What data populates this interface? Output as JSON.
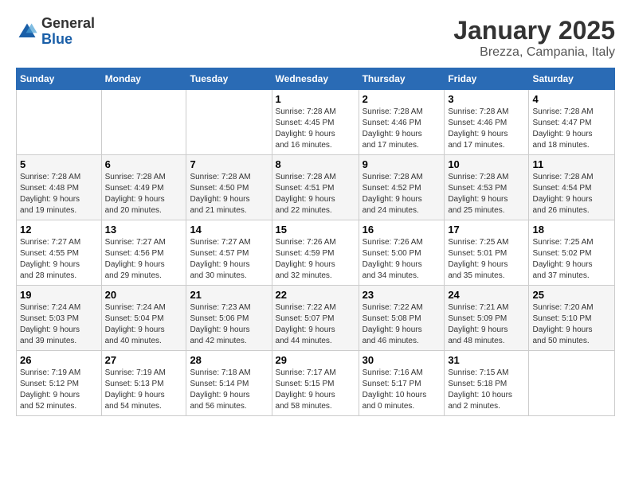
{
  "logo": {
    "general": "General",
    "blue": "Blue"
  },
  "header": {
    "month": "January 2025",
    "location": "Brezza, Campania, Italy"
  },
  "days_of_week": [
    "Sunday",
    "Monday",
    "Tuesday",
    "Wednesday",
    "Thursday",
    "Friday",
    "Saturday"
  ],
  "weeks": [
    [
      {
        "day": "",
        "info": ""
      },
      {
        "day": "",
        "info": ""
      },
      {
        "day": "",
        "info": ""
      },
      {
        "day": "1",
        "info": "Sunrise: 7:28 AM\nSunset: 4:45 PM\nDaylight: 9 hours\nand 16 minutes."
      },
      {
        "day": "2",
        "info": "Sunrise: 7:28 AM\nSunset: 4:46 PM\nDaylight: 9 hours\nand 17 minutes."
      },
      {
        "day": "3",
        "info": "Sunrise: 7:28 AM\nSunset: 4:46 PM\nDaylight: 9 hours\nand 17 minutes."
      },
      {
        "day": "4",
        "info": "Sunrise: 7:28 AM\nSunset: 4:47 PM\nDaylight: 9 hours\nand 18 minutes."
      }
    ],
    [
      {
        "day": "5",
        "info": "Sunrise: 7:28 AM\nSunset: 4:48 PM\nDaylight: 9 hours\nand 19 minutes."
      },
      {
        "day": "6",
        "info": "Sunrise: 7:28 AM\nSunset: 4:49 PM\nDaylight: 9 hours\nand 20 minutes."
      },
      {
        "day": "7",
        "info": "Sunrise: 7:28 AM\nSunset: 4:50 PM\nDaylight: 9 hours\nand 21 minutes."
      },
      {
        "day": "8",
        "info": "Sunrise: 7:28 AM\nSunset: 4:51 PM\nDaylight: 9 hours\nand 22 minutes."
      },
      {
        "day": "9",
        "info": "Sunrise: 7:28 AM\nSunset: 4:52 PM\nDaylight: 9 hours\nand 24 minutes."
      },
      {
        "day": "10",
        "info": "Sunrise: 7:28 AM\nSunset: 4:53 PM\nDaylight: 9 hours\nand 25 minutes."
      },
      {
        "day": "11",
        "info": "Sunrise: 7:28 AM\nSunset: 4:54 PM\nDaylight: 9 hours\nand 26 minutes."
      }
    ],
    [
      {
        "day": "12",
        "info": "Sunrise: 7:27 AM\nSunset: 4:55 PM\nDaylight: 9 hours\nand 28 minutes."
      },
      {
        "day": "13",
        "info": "Sunrise: 7:27 AM\nSunset: 4:56 PM\nDaylight: 9 hours\nand 29 minutes."
      },
      {
        "day": "14",
        "info": "Sunrise: 7:27 AM\nSunset: 4:57 PM\nDaylight: 9 hours\nand 30 minutes."
      },
      {
        "day": "15",
        "info": "Sunrise: 7:26 AM\nSunset: 4:59 PM\nDaylight: 9 hours\nand 32 minutes."
      },
      {
        "day": "16",
        "info": "Sunrise: 7:26 AM\nSunset: 5:00 PM\nDaylight: 9 hours\nand 34 minutes."
      },
      {
        "day": "17",
        "info": "Sunrise: 7:25 AM\nSunset: 5:01 PM\nDaylight: 9 hours\nand 35 minutes."
      },
      {
        "day": "18",
        "info": "Sunrise: 7:25 AM\nSunset: 5:02 PM\nDaylight: 9 hours\nand 37 minutes."
      }
    ],
    [
      {
        "day": "19",
        "info": "Sunrise: 7:24 AM\nSunset: 5:03 PM\nDaylight: 9 hours\nand 39 minutes."
      },
      {
        "day": "20",
        "info": "Sunrise: 7:24 AM\nSunset: 5:04 PM\nDaylight: 9 hours\nand 40 minutes."
      },
      {
        "day": "21",
        "info": "Sunrise: 7:23 AM\nSunset: 5:06 PM\nDaylight: 9 hours\nand 42 minutes."
      },
      {
        "day": "22",
        "info": "Sunrise: 7:22 AM\nSunset: 5:07 PM\nDaylight: 9 hours\nand 44 minutes."
      },
      {
        "day": "23",
        "info": "Sunrise: 7:22 AM\nSunset: 5:08 PM\nDaylight: 9 hours\nand 46 minutes."
      },
      {
        "day": "24",
        "info": "Sunrise: 7:21 AM\nSunset: 5:09 PM\nDaylight: 9 hours\nand 48 minutes."
      },
      {
        "day": "25",
        "info": "Sunrise: 7:20 AM\nSunset: 5:10 PM\nDaylight: 9 hours\nand 50 minutes."
      }
    ],
    [
      {
        "day": "26",
        "info": "Sunrise: 7:19 AM\nSunset: 5:12 PM\nDaylight: 9 hours\nand 52 minutes."
      },
      {
        "day": "27",
        "info": "Sunrise: 7:19 AM\nSunset: 5:13 PM\nDaylight: 9 hours\nand 54 minutes."
      },
      {
        "day": "28",
        "info": "Sunrise: 7:18 AM\nSunset: 5:14 PM\nDaylight: 9 hours\nand 56 minutes."
      },
      {
        "day": "29",
        "info": "Sunrise: 7:17 AM\nSunset: 5:15 PM\nDaylight: 9 hours\nand 58 minutes."
      },
      {
        "day": "30",
        "info": "Sunrise: 7:16 AM\nSunset: 5:17 PM\nDaylight: 10 hours\nand 0 minutes."
      },
      {
        "day": "31",
        "info": "Sunrise: 7:15 AM\nSunset: 5:18 PM\nDaylight: 10 hours\nand 2 minutes."
      },
      {
        "day": "",
        "info": ""
      }
    ]
  ]
}
